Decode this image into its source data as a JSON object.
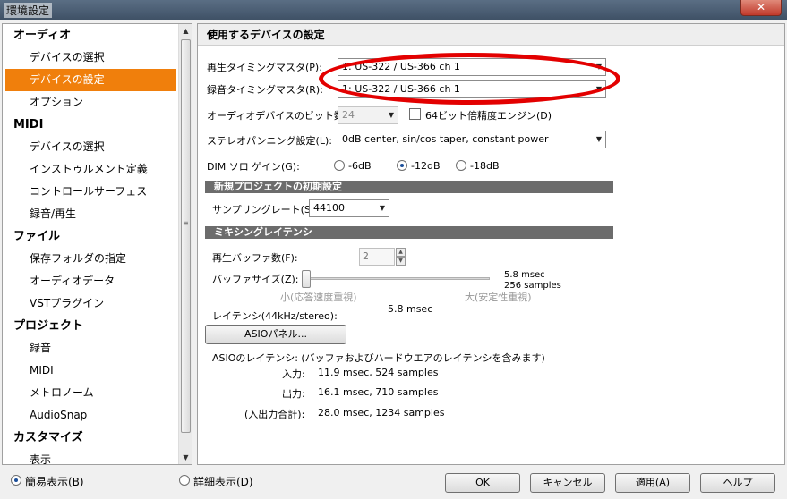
{
  "window": {
    "title": "環境設定",
    "close_label": "✕"
  },
  "sidebar": {
    "items": [
      {
        "label": "オーディオ",
        "kind": "cat"
      },
      {
        "label": "デバイスの選択",
        "kind": "item"
      },
      {
        "label": "デバイスの設定",
        "kind": "item",
        "selected": true
      },
      {
        "label": "オプション",
        "kind": "item"
      },
      {
        "label": "MIDI",
        "kind": "cat"
      },
      {
        "label": "デバイスの選択",
        "kind": "item"
      },
      {
        "label": "インストゥルメント定義",
        "kind": "item"
      },
      {
        "label": "コントロールサーフェス",
        "kind": "item"
      },
      {
        "label": "録音/再生",
        "kind": "item"
      },
      {
        "label": "ファイル",
        "kind": "cat"
      },
      {
        "label": "保存フォルダの指定",
        "kind": "item"
      },
      {
        "label": "オーディオデータ",
        "kind": "item"
      },
      {
        "label": "VSTプラグイン",
        "kind": "item"
      },
      {
        "label": "プロジェクト",
        "kind": "cat"
      },
      {
        "label": "録音",
        "kind": "item"
      },
      {
        "label": "MIDI",
        "kind": "item"
      },
      {
        "label": "メトロノーム",
        "kind": "item"
      },
      {
        "label": "AudioSnap",
        "kind": "item"
      },
      {
        "label": "カスタマイズ",
        "kind": "cat"
      },
      {
        "label": "表示",
        "kind": "item"
      }
    ],
    "scroll_up": "▲",
    "scroll_down": "▼",
    "scroll_grip": "≡"
  },
  "main": {
    "title": "使用するデバイスの設定",
    "playback_master": {
      "label": "再生タイミングマスタ(P):",
      "value": "1: US-322 / US-366 ch 1"
    },
    "record_master": {
      "label": "録音タイミングマスタ(R):",
      "value": "1: US-322 / US-366 ch 1"
    },
    "bit_depth": {
      "label": "オーディオデバイスのビット数(T):",
      "value": "24"
    },
    "engine64": {
      "label": "64ビット倍精度エンジン(D)"
    },
    "panning": {
      "label": "ステレオパンニング設定(L):",
      "value": "0dB center, sin/cos taper, constant power"
    },
    "dim_solo": {
      "label": "DIM ソロ ゲイン(G):",
      "options": [
        "-6dB",
        "-12dB",
        "-18dB"
      ],
      "selected_index": 1
    },
    "new_project_section": "新規プロジェクトの初期設定",
    "sample_rate": {
      "label": "サンプリングレート(S):",
      "value": "44100"
    },
    "mixing_section": "ミキシングレイテンシ",
    "buffer_count": {
      "label": "再生バッファ数(F):",
      "value": "2"
    },
    "buffer_size": {
      "label": "バッファサイズ(Z):",
      "msec": "5.8 msec",
      "samples": "256 samples",
      "min_label": "小(応答速度重視)",
      "max_label": "大(安定性重視)",
      "level": 0.0
    },
    "latency": {
      "label": "レイテンシ(44kHz/stereo):",
      "value": "5.8 msec"
    },
    "asio_button": "ASIOパネル...",
    "asio_latency": {
      "title": "ASIOのレイテンシ: (バッファおよびハードウエアのレイテンシを含みます)",
      "input_label": "入力:",
      "input_value": "11.9 msec, 524 samples",
      "output_label": "出力:",
      "output_value": "16.1 msec, 710 samples",
      "total_label": "(入出力合計):",
      "total_value": "28.0 msec, 1234 samples"
    }
  },
  "footer": {
    "simple_view": "簡易表示(B)",
    "detail_view": "詳細表示(D)",
    "ok": "OK",
    "cancel": "キャンセル",
    "apply": "適用(A)",
    "help": "ヘルプ"
  },
  "colors": {
    "selected": "#f07f0c",
    "highlight_oval": "#e30000",
    "section_bar": "#6c6c6c"
  },
  "icons": {
    "dropdown": "▼",
    "spin_up": "▲",
    "spin_down": "▼"
  }
}
